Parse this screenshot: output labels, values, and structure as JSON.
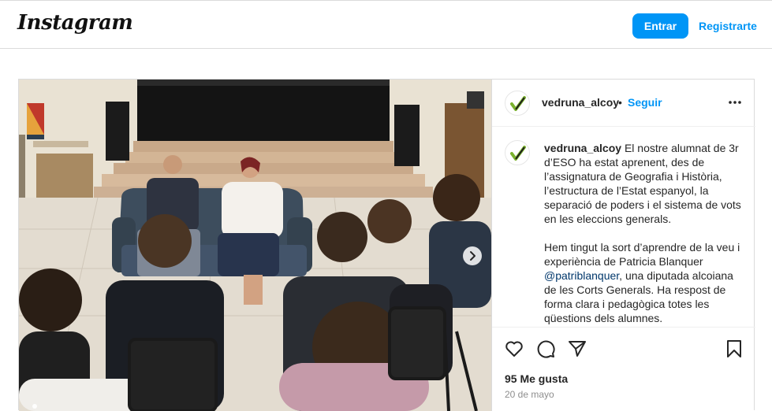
{
  "header": {
    "logo": "Instagram",
    "login_label": "Entrar",
    "signup_label": "Registrarte"
  },
  "post": {
    "username": "vedruna_alcoy",
    "separator": "•",
    "follow_label": "Seguir",
    "caption_p1": "El nostre alumnat de 3r d’ESO ha estat aprenent, des de l’assignatura de Geografia i Història, l’estructura de l’Estat espanyol, la separació de poders i el sistema de vots en les eleccions generals.",
    "caption_p2_before": "Hem tingut la sort d’aprendre de la veu i experiència de Patricia Blanquer ",
    "caption_mention": "@patriblanquer",
    "caption_p2_after": ", una diputada alcoiana de les Corts Generals. Ha respost de forma clara i pedagògica totes les qüestions dels alumnes.",
    "likes": "95 Me gusta",
    "date": "20 de mayo"
  },
  "icons": {
    "like": "heart-icon",
    "comment": "comment-icon",
    "share": "send-icon",
    "save": "bookmark-icon",
    "more": "more-options-icon",
    "next": "chevron-right-icon"
  },
  "colors": {
    "accent": "#0095f6",
    "brand_green": "#7bb32e"
  }
}
